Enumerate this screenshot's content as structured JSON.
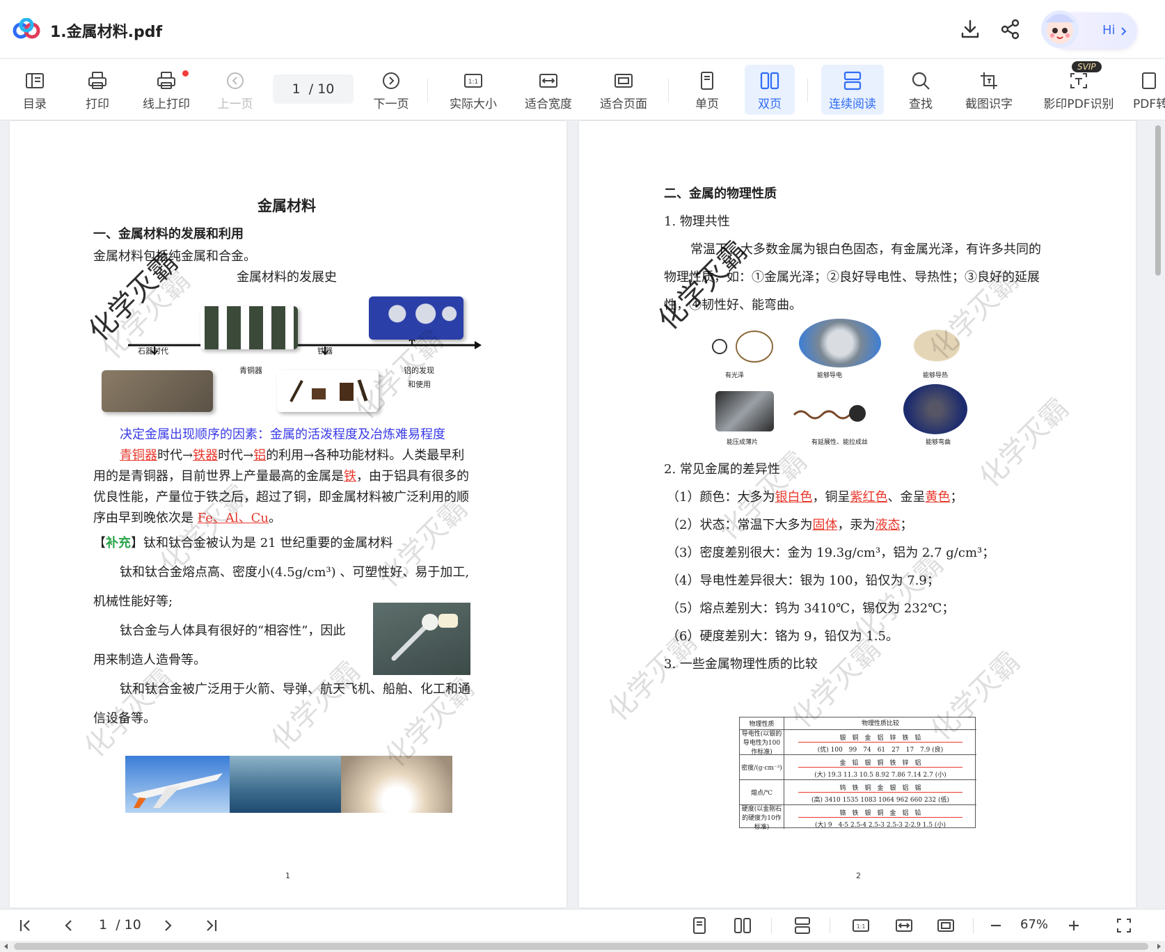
{
  "app": {
    "file_title": "1.金属材料.pdf",
    "ai_label": "Hi",
    "svip_badge": "SVIP"
  },
  "toolbar": {
    "items": [
      {
        "label": "目录",
        "icon": "toc-icon"
      },
      {
        "label": "打印",
        "icon": "printer-icon"
      },
      {
        "label": "线上打印",
        "icon": "online-print-icon"
      },
      {
        "label": "上一页",
        "icon": "prev-page-icon",
        "disabled": true
      },
      {
        "label": "下一页",
        "icon": "next-page-icon"
      },
      {
        "label": "实际大小",
        "icon": "actual-size-icon"
      },
      {
        "label": "适合宽度",
        "icon": "fit-width-icon"
      },
      {
        "label": "适合页面",
        "icon": "fit-page-icon"
      },
      {
        "label": "单页",
        "icon": "single-page-icon"
      },
      {
        "label": "双页",
        "icon": "double-page-icon",
        "active": true
      },
      {
        "label": "连续阅读",
        "icon": "continuous-icon",
        "active": true
      },
      {
        "label": "查找",
        "icon": "search-icon"
      },
      {
        "label": "截图识字",
        "icon": "screenshot-ocr-icon"
      },
      {
        "label": "影印PDF识别",
        "icon": "scan-pdf-ocr-icon"
      },
      {
        "label": "PDF转",
        "icon": "pdf-convert-icon"
      }
    ],
    "page_current": "1",
    "page_total": "/ 10"
  },
  "page1": {
    "title": "金属材料",
    "section1": "一、金属材料的发展和利用",
    "line1": "金属材料包括纯金属和合金。",
    "fig_caption": "金属材料的发展史",
    "timeline": {
      "stone": "石器时代",
      "bronze": "青铜器",
      "iron": "铁器",
      "al1": "铝的发现",
      "al2": "和使用"
    },
    "factor": "决定金属出现顺序的因素：金属的活泼程度及冶炼难易程度",
    "p1_a": "青铜器",
    "p1_b": "时代→",
    "p1_c": "铁器",
    "p1_d": "时代→",
    "p1_e": "铝",
    "p1_f": "的利用→各种功能材料。人类最早利",
    "p2_a": "用的是青铜器，目前世界上产量最高的金属是",
    "p2_b": "铁",
    "p2_c": "，由于铝具有很多的",
    "p3": "优良性能，产量位于铁之后，超过了铜，即金属材料被广泛利用的顺",
    "p4_a": "序由早到晚依次是 ",
    "p4_b": "Fe、Al、Cu",
    "p4_c": "。",
    "supp_a": "【",
    "supp_b": "补充",
    "supp_c": "】钛和钛合金被认为是 21 世纪重要的金属材料",
    "ti1": "钛和钛合金熔点高、密度小(4.5g/cm³) 、可塑性好、易于加工,",
    "ti2": "机械性能好等;",
    "ti3": "钛合金与人体具有很好的“相容性”，因此",
    "ti4": "用来制造人造骨等。",
    "ti5": "钛和钛合金被广泛用于火箭、导弹、航天飞机、船舶、化工和通",
    "ti6": "信设备等。",
    "page_num": "1"
  },
  "page2": {
    "section2": "二、金属的物理性质",
    "sub1": "1. 物理共性",
    "c1": "常温下，大多数金属为银白色固态，有金属光泽，有许多共同的",
    "c2": "物理性质，如：①金属光泽；②良好导电性、导热性；③良好的延展",
    "c3": "性，④韧性好、能弯曲。",
    "img_labels": [
      "有光泽",
      "能够导电",
      "能够导热",
      "能压成薄片",
      "有延展性、能拉成丝",
      "能够弯曲"
    ],
    "sub2": "2. 常见金属的差异性",
    "d1_a": "（1）颜色：大多为",
    "d1_b": "银白色",
    "d1_c": "，铜呈",
    "d1_d": "紫红色",
    "d1_e": "、金呈",
    "d1_f": "黄色",
    "d1_g": "；",
    "d2_a": "（2）状态：常温下大多为",
    "d2_b": "固体",
    "d2_c": "，汞为",
    "d2_d": "液态",
    "d2_e": "；",
    "d3": "（3）密度差别很大：金为 19.3g/cm³，铝为 2.7 g/cm³；",
    "d4": "（4）导电性差异很大：银为 100，铅仅为 7.9；",
    "d5": "（5）熔点差别大：钨为 3410℃，锡仅为 232℃；",
    "d6": "（6）硬度差别大：铬为 9，铅仅为 1.5。",
    "sub3": "3. 一些金属物理性质的比较",
    "table": {
      "h1": "物理性质",
      "h2": "物理性质比较",
      "rows": [
        {
          "name": "导电性(以银的导电性为100作标准)",
          "metals": "银　铜　金　铝　锌　铁　铅",
          "values": "(优) 100　99　74　61　27　17　7.9 (良)"
        },
        {
          "name": "密度/(g·cm⁻³)",
          "metals": "金　铅　银　铜　铁　锌　铝",
          "values": "(大) 19.3 11.3 10.5 8.92 7.86 7.14 2.7 (小)"
        },
        {
          "name": "熔点/℃",
          "metals": "钨　铁　铜　金　银　铝　锡",
          "values": "(高) 3410 1535 1083 1064 962 660 232 (低)"
        },
        {
          "name": "硬度(以金刚石的硬度为10作标准)",
          "metals": "铬　铁　银　铜　金　铝　铅",
          "values": "(大) 9　4-5 2.5-4 2.5-3 2.5-3 2-2.9 1.5 (小)"
        }
      ]
    },
    "page_num": "2"
  },
  "watermark": "化学灭霸",
  "statusbar": {
    "page_current": "1",
    "page_total": "/ 10",
    "zoom": "67%"
  },
  "colors": {
    "accent": "#2f6cf6",
    "red_text": "#e8382c",
    "blue_text": "#3a3ae8",
    "green_text": "#2aa44a"
  }
}
